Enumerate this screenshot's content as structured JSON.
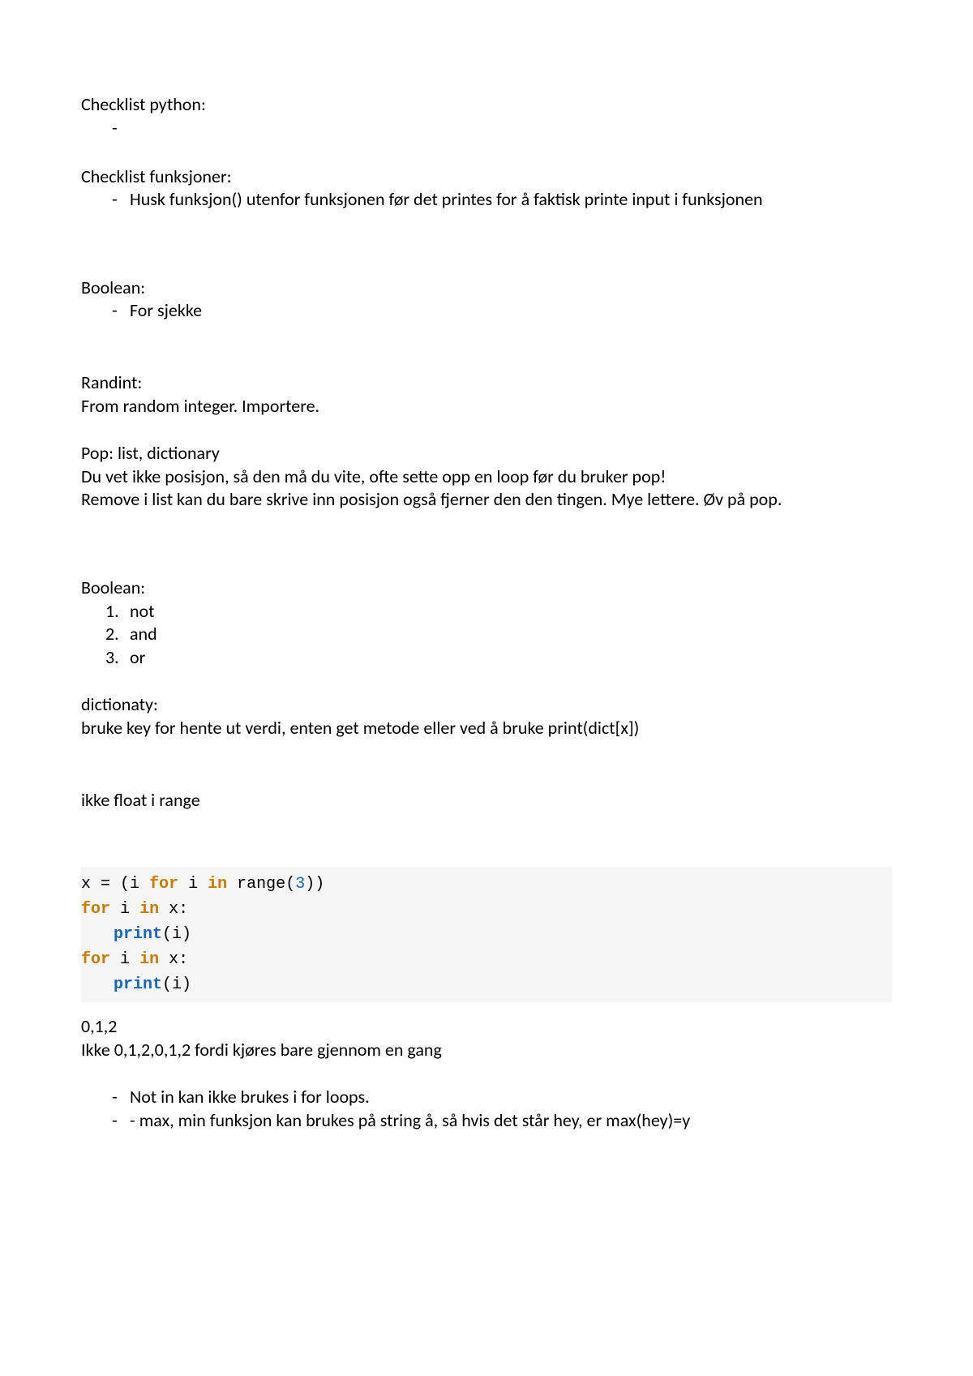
{
  "s1": {
    "title": "Checklist python:",
    "bullet_dash": "-"
  },
  "s2": {
    "title": "Checklist funksjoner:",
    "b1_dash": "-",
    "b1": "Husk funksjon() utenfor funksjonen før det printes for å faktisk printe input i funksjonen"
  },
  "s3": {
    "title": "Boolean:",
    "b1_dash": "-",
    "b1": "For sjekke"
  },
  "s4": {
    "title": "Randint:",
    "line": "From random integer. Importere."
  },
  "s5": {
    "title": "Pop: list, dictionary",
    "l1": "Du vet ikke posisjon, så den må du vite, ofte sette opp en loop før du bruker pop!",
    "l2": "Remove i list kan du bare skrive inn posisjon også fjerner den den tingen. Mye lettere. Øv på pop."
  },
  "s6": {
    "title": "Boolean:",
    "n1": "1.",
    "i1": "not",
    "n2": "2.",
    "i2": "and",
    "n3": "3.",
    "i3": "or"
  },
  "s7": {
    "title": "dictionaty:",
    "l1": "bruke key for hente ut verdi, enten get metode eller ved å bruke print(dict[x])"
  },
  "s8": {
    "l1": "ikke float i range"
  },
  "code": {
    "x": "x",
    "eq": " = ",
    "lp": "(",
    "rp": ")",
    "i": "i",
    "sp": " ",
    "for": "for",
    "in": "in",
    "range": "range",
    "three": "3",
    "colon": ":",
    "print": "print"
  },
  "s9": {
    "l1": "0,1,2",
    "l2": "Ikke 0,1,2,0,1,2 fordi kjøres bare gjennom en gang"
  },
  "s10": {
    "b1_dash": "-",
    "b1": "Not in kan ikke brukes i for loops.",
    "b2_dash": "-",
    "b2": "- max, min funksjon kan brukes på string å, så hvis det står hey, er max(hey)=y"
  }
}
